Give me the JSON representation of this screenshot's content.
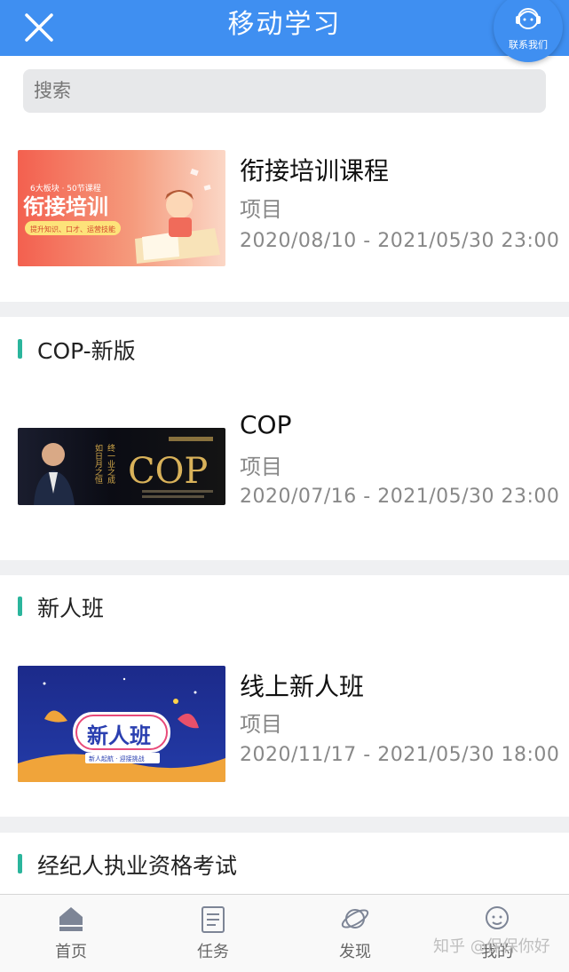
{
  "header": {
    "title": "移动学习",
    "contact_label": "联系我们"
  },
  "search": {
    "placeholder": "搜索"
  },
  "items": [
    {
      "title": "衔接培训课程",
      "type": "项目",
      "date": "2020/08/10 - 2021/05/30 23:00",
      "thumb": {
        "top_text": "6大板块 · 50节课程",
        "main_text": "衔接培训",
        "sub_text": "提升知识、口才、运营技能"
      }
    },
    {
      "title": "COP",
      "type": "项目",
      "date": "2020/07/16 - 2021/05/30 23:00",
      "thumb": {
        "main_text": "COP",
        "vert_a": "如日月之恒",
        "vert_b": "终一业之成"
      }
    },
    {
      "title": "线上新人班",
      "type": "项目",
      "date": "2020/11/17 - 2021/05/30 18:00",
      "thumb": {
        "main_text": "新人班",
        "sub_text": "新人起航 · 迎接挑战"
      }
    }
  ],
  "sections": [
    {
      "title": "COP-新版"
    },
    {
      "title": "新人班"
    },
    {
      "title": "经纪人执业资格考试"
    }
  ],
  "tabs": [
    {
      "label": "首页",
      "icon": "home-icon"
    },
    {
      "label": "任务",
      "icon": "task-icon"
    },
    {
      "label": "发现",
      "icon": "planet-icon"
    },
    {
      "label": "我的",
      "icon": "profile-icon"
    }
  ],
  "watermark": "知乎 @保保你好",
  "colors": {
    "header_bg": "#3f8ff1",
    "section_bar": "#2bb59c",
    "gap": "#eff0f2"
  }
}
